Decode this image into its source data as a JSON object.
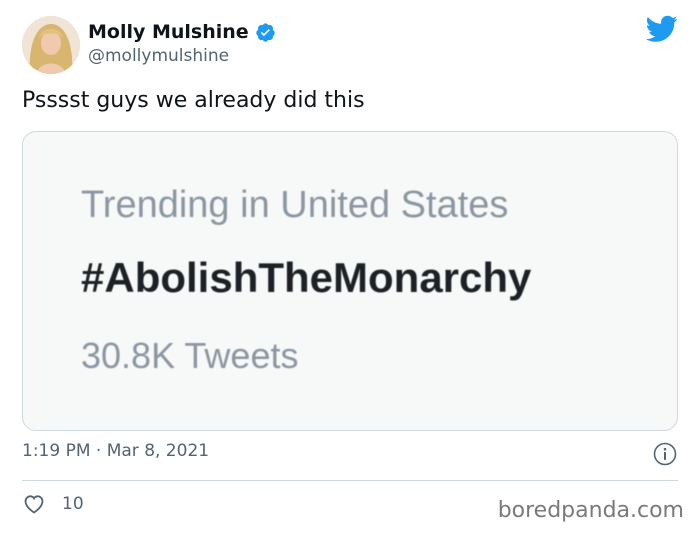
{
  "author": {
    "display_name": "Molly Mulshine",
    "handle": "@mollymulshine",
    "verified": true
  },
  "tweet": {
    "text": "Psssst guys we already did this",
    "timestamp": "1:19 PM · Mar 8, 2021",
    "likes": "10"
  },
  "media": {
    "trend_label": "Trending in United States",
    "trend_hashtag": "#AbolishTheMonarchy",
    "trend_count": "30.8K Tweets"
  },
  "watermark": "boredpanda.com",
  "icons": {
    "brand": "twitter-bird-icon",
    "verified": "verified-badge-icon",
    "info": "info-icon",
    "like": "heart-icon"
  },
  "colors": {
    "twitter_blue": "#1d9bf0",
    "text_secondary": "#536471",
    "border": "#cfd9de"
  }
}
